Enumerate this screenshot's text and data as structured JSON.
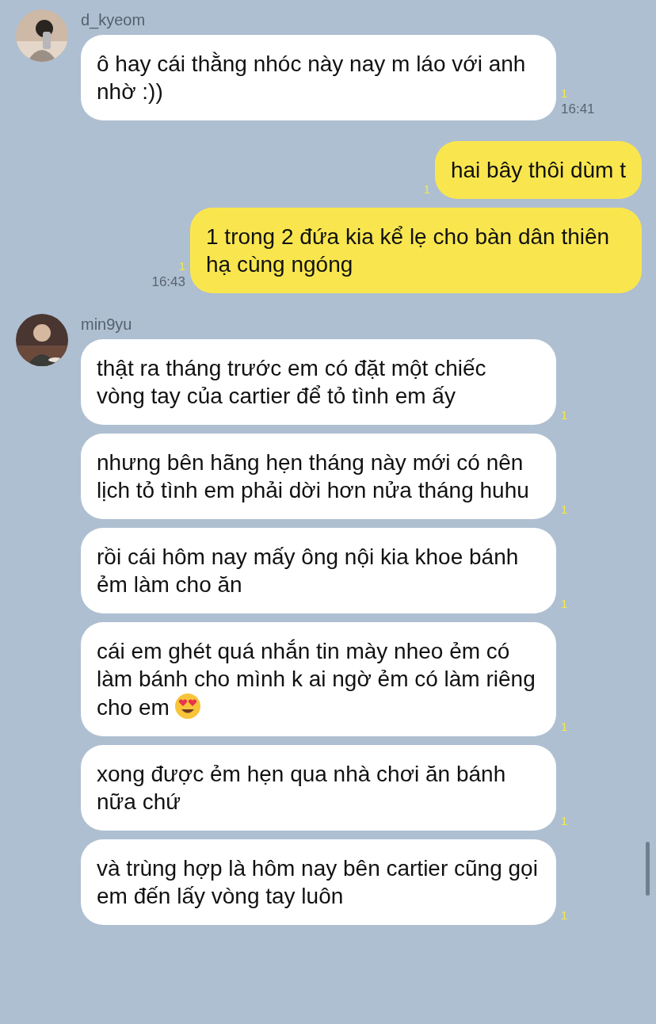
{
  "groups": [
    {
      "kind": "incoming",
      "sender": "d_kyeom",
      "avatar": {
        "kind": "picture"
      },
      "messages": [
        {
          "text": "ô hay cái thằng nhóc này nay m láo với anh nhờ :))",
          "read": "1",
          "time": "16:41"
        }
      ]
    },
    {
      "kind": "outgoing",
      "messages": [
        {
          "text": "hai bây thôi dùm t",
          "read": "1"
        },
        {
          "text": "1 trong 2 đứa kia kể lẹ cho bàn dân thiên hạ cùng ngóng",
          "read": "1",
          "time": "16:43"
        }
      ]
    },
    {
      "kind": "incoming",
      "sender": "min9yu",
      "avatar": {
        "kind": "picture"
      },
      "messages": [
        {
          "text": "thật ra tháng trước em có đặt một chiếc vòng tay của cartier để tỏ tình em ấy",
          "read": "1"
        },
        {
          "text": "nhưng bên hãng hẹn tháng này mới có nên lịch tỏ tình em phải dời hơn nửa tháng huhu",
          "read": "1"
        },
        {
          "text": "rồi cái hôm nay mấy ông nội kia khoe bánh ẻm làm cho ăn",
          "read": "1"
        },
        {
          "text": "cái em ghét quá nhắn tin mày nheo ẻm có làm bánh cho mình k ai ngờ ẻm có làm riêng cho em",
          "trailing_emoji": true,
          "read": "1"
        },
        {
          "text": "xong được ẻm hẹn qua nhà chơi ăn bánh nữa chứ",
          "read": "1"
        },
        {
          "text": "và trùng hợp là hôm nay bên cartier cũng gọi em đến lấy vòng tay luôn",
          "read": "1"
        }
      ]
    }
  ]
}
